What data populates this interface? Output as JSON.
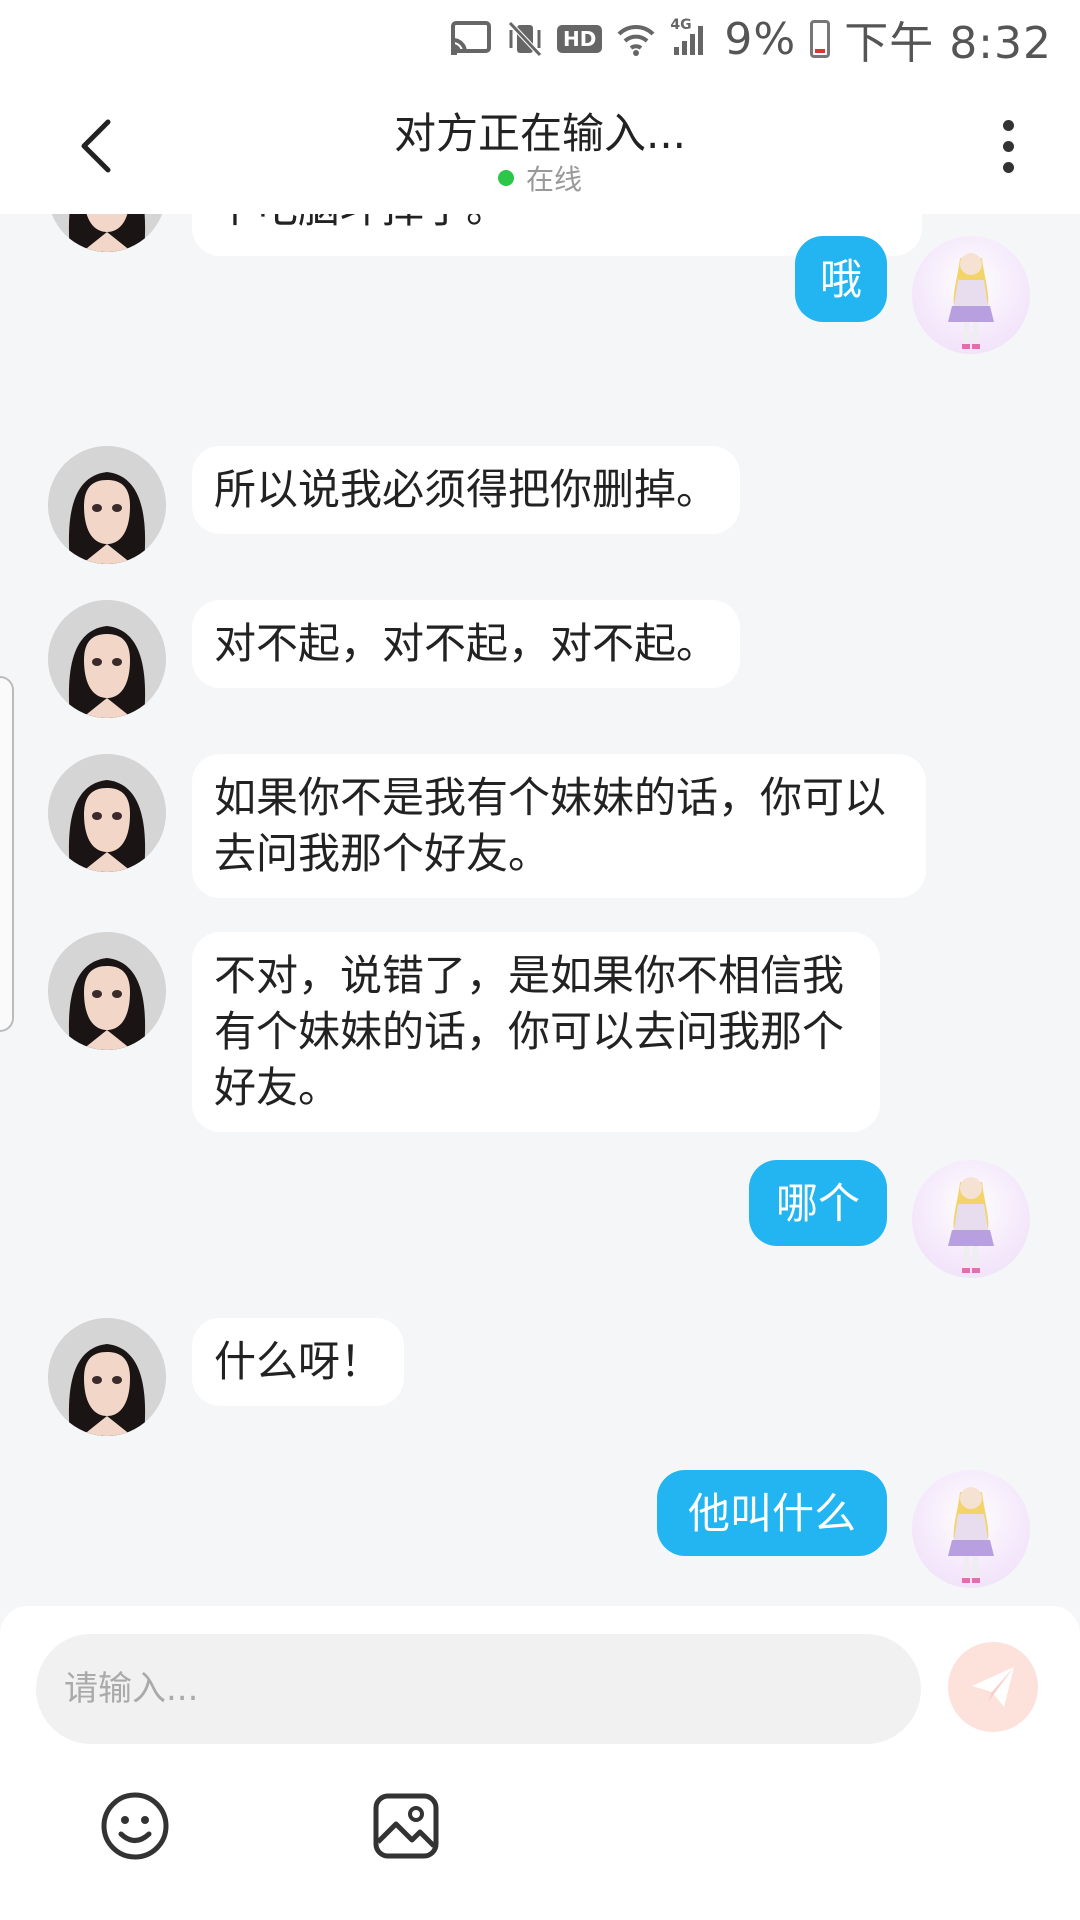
{
  "status_bar": {
    "battery": "9%",
    "time": "下午 8:32",
    "hd": "HD",
    "network": "4G",
    "icons": [
      "cast-icon",
      "vibrate-mute-icon",
      "hd-icon",
      "wifi-icon",
      "signal-icon",
      "battery-icon"
    ]
  },
  "header": {
    "title": "对方正在输入...",
    "status": "在线",
    "status_color": "#2cc64b"
  },
  "messages": [
    {
      "side": "in",
      "text": "个电脑坏掉了。",
      "partial": true
    },
    {
      "side": "out",
      "text": "哦"
    },
    {
      "side": "in",
      "text": "所以说我必须得把你删掉。"
    },
    {
      "side": "in",
      "text": "对不起，对不起，对不起。"
    },
    {
      "side": "in",
      "text": "如果你不是我有个妹妹的话，你可以去问我那个好友。"
    },
    {
      "side": "in",
      "text": "不对，说错了，是如果你不相信我有个妹妹的话，你可以去问我那个好友。"
    },
    {
      "side": "out",
      "text": "哪个"
    },
    {
      "side": "in",
      "text": "什么呀！"
    },
    {
      "side": "out",
      "text": "他叫什么"
    }
  ],
  "composer": {
    "placeholder": "请输入...",
    "send_color": "#fde2dc",
    "tools": [
      "emoji-icon",
      "image-icon"
    ]
  },
  "colors": {
    "outgoing_bubble": "#22b5f2",
    "incoming_bubble": "#ffffff",
    "background": "#f5f6f8"
  }
}
